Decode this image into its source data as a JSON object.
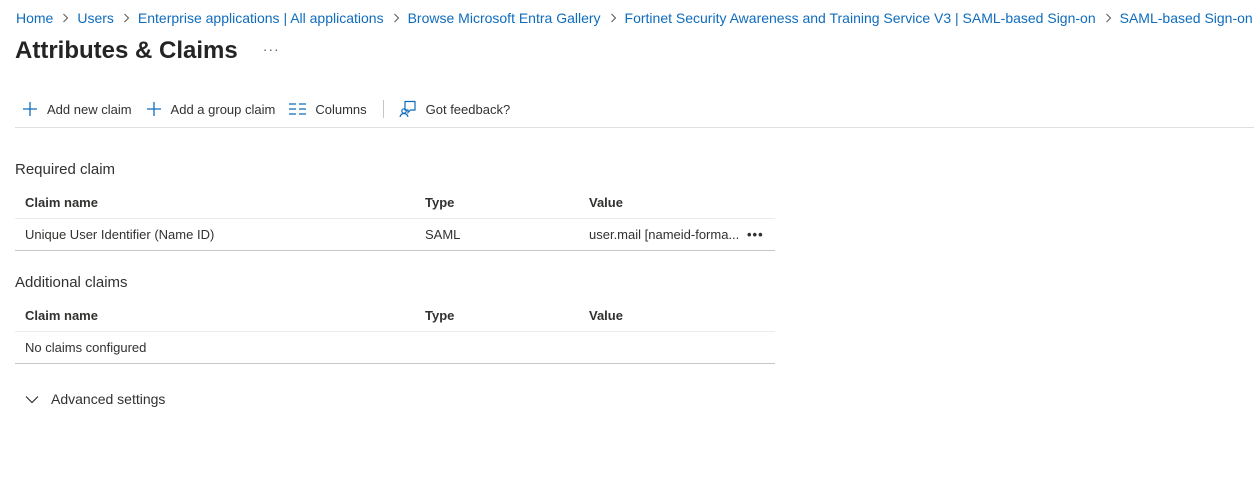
{
  "breadcrumb": [
    "Home",
    "Users",
    "Enterprise applications | All applications",
    "Browse Microsoft Entra Gallery",
    "Fortinet Security Awareness and Training Service V3 | SAML-based Sign-on",
    "SAML-based Sign-on"
  ],
  "page": {
    "title": "Attributes & Claims",
    "more_label": "···"
  },
  "toolbar": {
    "add_claim": "Add new claim",
    "add_group_claim": "Add a group claim",
    "columns": "Columns",
    "feedback": "Got feedback?"
  },
  "required": {
    "title": "Required claim",
    "headers": {
      "name": "Claim name",
      "type": "Type",
      "value": "Value"
    },
    "rows": [
      {
        "name": "Unique User Identifier (Name ID)",
        "type": "SAML",
        "value": "user.mail [nameid-forma...",
        "more": "•••"
      }
    ]
  },
  "additional": {
    "title": "Additional claims",
    "headers": {
      "name": "Claim name",
      "type": "Type",
      "value": "Value"
    },
    "empty": "No claims configured"
  },
  "advanced": {
    "label": "Advanced settings"
  },
  "colors": {
    "link": "#0f6cbd",
    "icon": "#0f6cbd",
    "text": "#323130"
  }
}
